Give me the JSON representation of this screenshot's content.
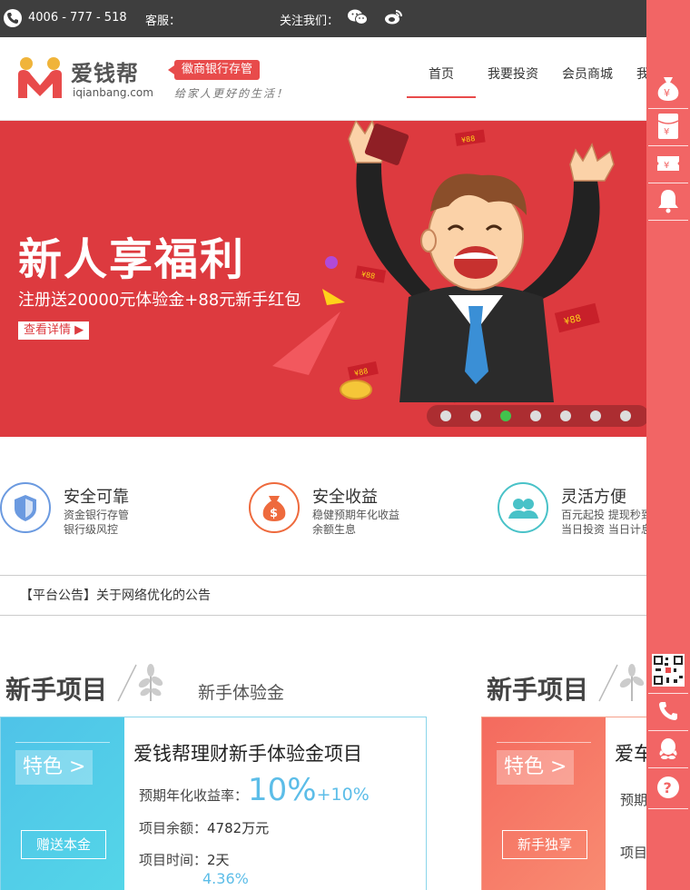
{
  "topbar": {
    "phone": "4006 - 777 - 518",
    "service_label": "客服：",
    "follow_label": "关注我们："
  },
  "header": {
    "brand_cn": "爱钱帮",
    "brand_en": "iqianbang.com",
    "bank_tag": "徽商银行存管",
    "slogan": "给家人更好的生活！",
    "nav": [
      "首页",
      "我要投资",
      "会员商城",
      "我的"
    ]
  },
  "banner": {
    "title": "新人享福利",
    "subtitle": "注册送20000元体验金+88元新手红包",
    "button": "查看详情",
    "envelope_text": "¥88",
    "slide_count": 7,
    "active_slide": 3
  },
  "features": [
    {
      "title": "安全可靠",
      "lines": [
        "资金银行存管",
        "银行级风控"
      ],
      "color": "#6b9ae0"
    },
    {
      "title": "安全收益",
      "lines": [
        "稳健预期年化收益",
        "余额生息"
      ],
      "color": "#ee6a3d"
    },
    {
      "title": "灵活方便",
      "lines": [
        "百元起投 提现秒到",
        "当日投资 当日计息"
      ],
      "color": "#49c2c8"
    }
  ],
  "notice": "【平台公告】关于网络优化的公告",
  "sections": {
    "left_title": "新手项目",
    "left_sub": "新手体验金",
    "right_title": "新手项目"
  },
  "card1": {
    "badge": "特色 >",
    "button": "赠送本金",
    "title": "爱钱帮理财新手体验金项目",
    "rate_label": "预期年化收益率：",
    "rate": "10%",
    "rate_plus": "+10%",
    "balance_label": "项目余额：",
    "balance": "4782万元",
    "time_label": "项目时间：",
    "time": "2天",
    "extra": "4.36%"
  },
  "card2": {
    "badge": "特色 >",
    "button": "新手独享",
    "title": "爱车",
    "line1": "预期",
    "line2": "项目"
  },
  "colors": {
    "brand_red": "#dd3a3f",
    "sidebar": "#f26565",
    "accent_blue": "#5cbde8"
  }
}
